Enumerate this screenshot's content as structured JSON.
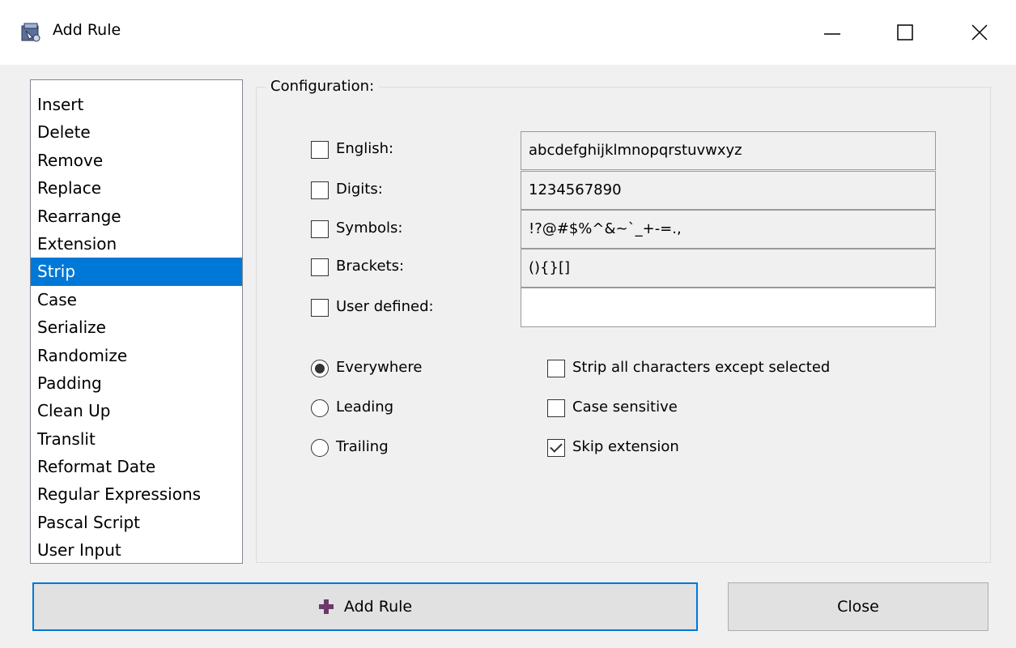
{
  "window": {
    "title": "Add Rule",
    "icon": "app-icon",
    "controls": {
      "minimize": "minimize-icon",
      "maximize": "maximize-icon",
      "close": "close-icon"
    }
  },
  "rules": {
    "items": [
      "Insert",
      "Delete",
      "Remove",
      "Replace",
      "Rearrange",
      "Extension",
      "Strip",
      "Case",
      "Serialize",
      "Randomize",
      "Padding",
      "Clean Up",
      "Translit",
      "Reformat Date",
      "Regular Expressions",
      "Pascal Script",
      "User Input"
    ],
    "selected": "Strip",
    "selected_color": "#0078d7"
  },
  "config": {
    "legend": "Configuration:",
    "char_sets": [
      {
        "label": "English:",
        "value": "abcdefghijklmnopqrstuvwxyz",
        "checked": false
      },
      {
        "label": "Digits:",
        "value": "1234567890",
        "checked": false
      },
      {
        "label": "Symbols:",
        "value": "!?@#$%^&~`_+-=.,",
        "checked": false
      },
      {
        "label": "Brackets:",
        "value": "(){}[]",
        "checked": false
      },
      {
        "label": "User defined:",
        "value": "",
        "checked": false
      }
    ],
    "position": {
      "options": [
        "Everywhere",
        "Leading",
        "Trailing"
      ],
      "selected": "Everywhere"
    },
    "options": [
      {
        "label": "Strip all characters except selected",
        "checked": false
      },
      {
        "label": "Case sensitive",
        "checked": false
      },
      {
        "label": "Skip extension",
        "checked": true
      }
    ]
  },
  "buttons": {
    "add_rule": "Add Rule",
    "add_rule_icon": "plus-icon",
    "close": "Close",
    "accent": "#0078d7"
  }
}
